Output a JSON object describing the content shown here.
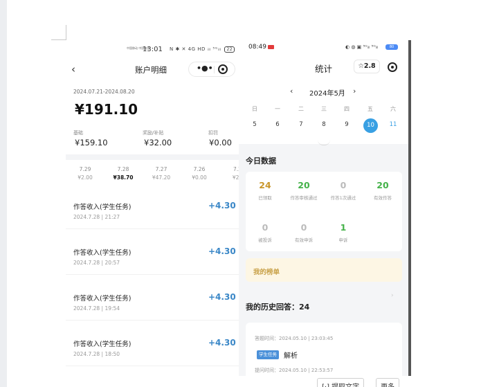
{
  "left": {
    "status_bar": {
      "carrier": "中国移动 中国电信",
      "time": "13:01",
      "icons": "N ✱ ✕ 4G HD ᵢₗₗ ⁵ᴳᵢₗₗ",
      "battery": "22"
    },
    "nav": {
      "back": "‹",
      "title": "账户明细",
      "more": "•●•"
    },
    "date_range": "2024.07.21-2024.08.20",
    "total": "¥191.10",
    "stats": [
      {
        "label": "基础",
        "value": "¥159.10"
      },
      {
        "label": "奖励/补贴",
        "value": "¥32.00"
      },
      {
        "label": "扣罚",
        "value": "¥0.00"
      }
    ],
    "days": [
      {
        "date": "7.29",
        "amount": "¥2.00"
      },
      {
        "date": "7.28",
        "amount": "¥38.70"
      },
      {
        "date": "7.27",
        "amount": "¥47.20"
      },
      {
        "date": "7.26",
        "amount": "¥0.00"
      },
      {
        "date": "7.2",
        "amount": "¥21"
      }
    ],
    "transactions": [
      {
        "title": "作答收入(学生任务)",
        "time": "2024.7.28 | 21:27",
        "amount": "+4.30"
      },
      {
        "title": "作答收入(学生任务)",
        "time": "2024.7.28 | 20:57",
        "amount": "+4.30"
      },
      {
        "title": "作答收入(学生任务)",
        "time": "2024.7.28 | 19:54",
        "amount": "+4.30"
      },
      {
        "title": "作答收入(学生任务)",
        "time": "2024.7.28 | 18:50",
        "amount": "+4.30"
      }
    ]
  },
  "right": {
    "status_bar": {
      "time": "08:49",
      "icons": "◐ ◍ ▣ ⁵ᴳᵢₗₗ ⁵ᴳᵢₗₗ",
      "battery": "80"
    },
    "title": "统计",
    "rating": "☆2.8",
    "calendar": {
      "prev": "‹",
      "month": "2024年5月",
      "next": "›",
      "weekdays": [
        "日",
        "一",
        "二",
        "三",
        "四",
        "五",
        "六"
      ],
      "dates": [
        "5",
        "6",
        "7",
        "8",
        "9",
        "10",
        "11"
      ]
    },
    "today_title": "今日数据",
    "today_stats_row1": [
      {
        "value": "24",
        "label": "已领取",
        "color": "#c9962a"
      },
      {
        "value": "20",
        "label": "作答审核通过",
        "color": "#45b24a"
      },
      {
        "value": "0",
        "label": "作答1次通过",
        "color": "#bbbbbb"
      },
      {
        "value": "20",
        "label": "有效作答",
        "color": "#45b24a"
      }
    ],
    "today_stats_row2": [
      {
        "value": "0",
        "label": "被投诉",
        "color": "#bbbbbb"
      },
      {
        "value": "0",
        "label": "有效申诉",
        "color": "#bbbbbb"
      },
      {
        "value": "1",
        "label": "申诉",
        "color": "#45b24a"
      }
    ],
    "rank_label": "我的榜单",
    "rank_arrow": "›",
    "history_title": "我的历史回答：24",
    "history_item": {
      "answer_time": "答题时间：2024.05.10 | 23:03:45",
      "tag": "学生任务",
      "title": "解析",
      "question_time": "提问时间：2024.05.10 | 22:53:57"
    }
  },
  "doc_buttons": [
    "[⋅] 提取文字",
    "更多"
  ]
}
